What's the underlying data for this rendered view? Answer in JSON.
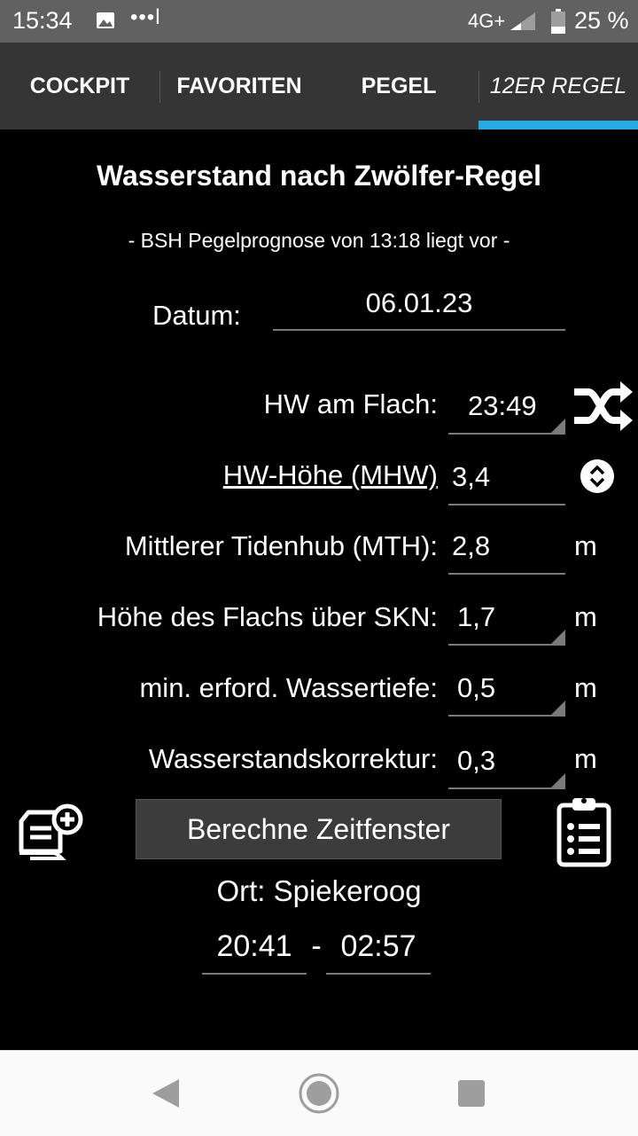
{
  "status": {
    "time": "15:34",
    "dots": "•••l",
    "network": "4G+",
    "battery": "25 %"
  },
  "tabs": [
    {
      "label": "COCKPIT"
    },
    {
      "label": "FAVORITEN"
    },
    {
      "label": "PEGEL"
    },
    {
      "label": "12ER REGEL",
      "active": true
    }
  ],
  "main": {
    "title": "Wasserstand nach Zwölfer-Regel",
    "subtitle": "- BSH Pegelprognose von 13:18 liegt vor -",
    "date_label": "Datum:",
    "date_value": "06.01.23",
    "hw_label": "HW am Flach:",
    "hw_value": "23:49",
    "hw_height_label": "HW-Höhe (MHW)",
    "hw_height_value": "3,4",
    "mth_label": "Mittlerer Tidenhub (MTH):",
    "mth_value": "2,8",
    "mth_unit": "m",
    "flach_label": "Höhe des Flachs über SKN:",
    "flach_value": "1,7",
    "flach_unit": "m",
    "depth_label": "min. erford. Wassertiefe:",
    "depth_value": "0,5",
    "depth_unit": "m",
    "corr_label": "Wasserstandskorrektur:",
    "corr_value": "0,3",
    "corr_unit": "m",
    "calc_button": "Berechne Zeitfenster",
    "location": "Ort: Spiekeroog",
    "window_start": "20:41",
    "window_sep": "-",
    "window_end": "02:57"
  },
  "colors": {
    "accent": "#27a9e1",
    "background": "#000000",
    "tabbar": "#353535",
    "statusbar": "#616161"
  },
  "icons": [
    "shuffle-icon",
    "up-down-icon",
    "note-add-icon",
    "clipboard-list-icon",
    "back-icon",
    "home-icon",
    "recents-icon"
  ]
}
